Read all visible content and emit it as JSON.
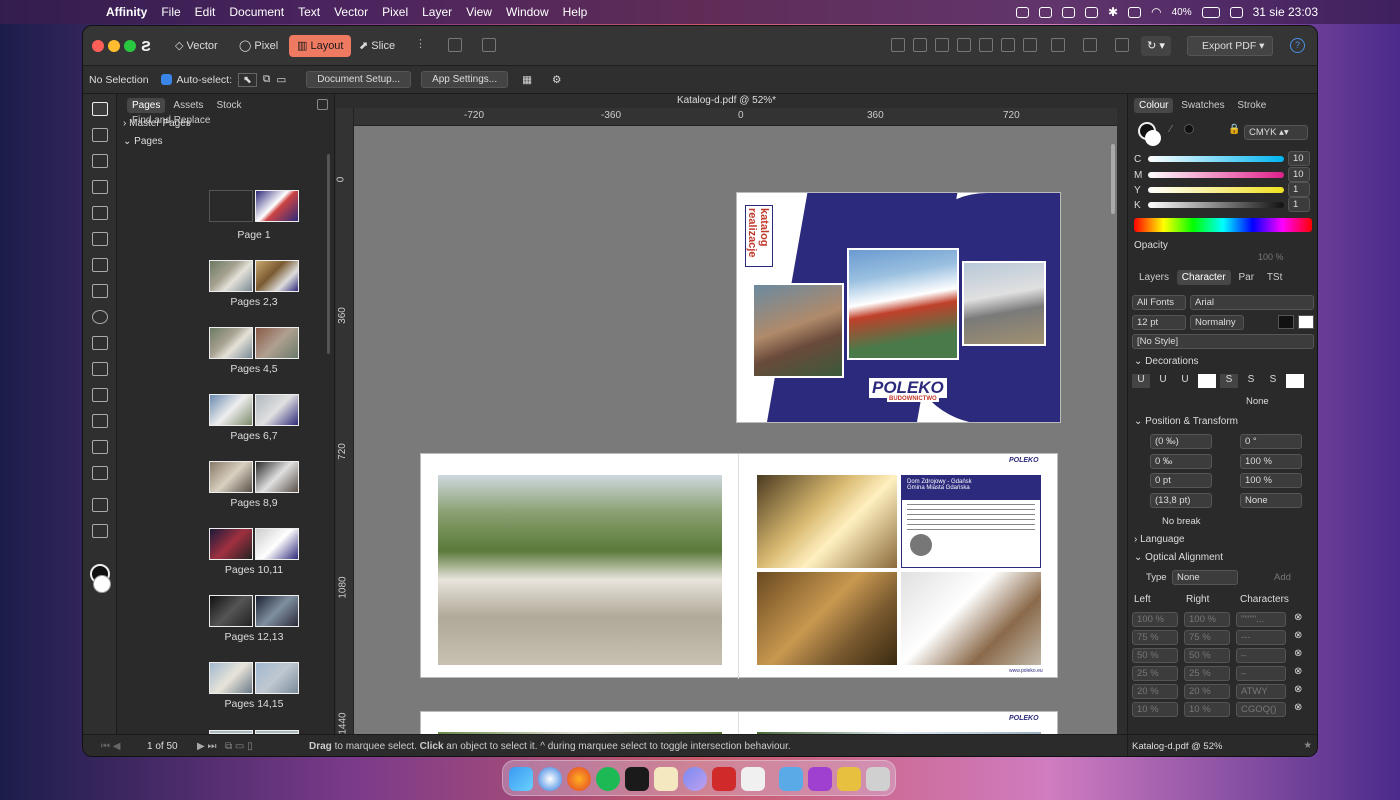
{
  "menubar": {
    "app": "Affinity",
    "items": [
      "File",
      "Edit",
      "Document",
      "Text",
      "Vector",
      "Pixel",
      "Layer",
      "View",
      "Window",
      "Help"
    ],
    "battery": "40%",
    "datetime": "31 sie  23:03"
  },
  "toolbar": {
    "personas": [
      "Vector",
      "Pixel",
      "Layout",
      "Slice"
    ],
    "active_persona": "Layout",
    "export": "Export PDF"
  },
  "context": {
    "selection": "No Selection",
    "autoselect": "Auto-select:",
    "doc_setup": "Document Setup...",
    "app_settings": "App Settings..."
  },
  "pages_panel": {
    "tabs": [
      "Pages",
      "Assets",
      "Stock",
      "Find and Replace"
    ],
    "master": "Master Pages",
    "pages_header": "Pages",
    "thumbs": [
      "Page 1",
      "Pages 2,3",
      "Pages 4,5",
      "Pages 6,7",
      "Pages 8,9",
      "Pages 10,11",
      "Pages 12,13",
      "Pages 14,15"
    ]
  },
  "document": {
    "title": "Katalog-d.pdf @ 52%*",
    "unit": "pt",
    "hticks": [
      "-720",
      "-360",
      "0",
      "360",
      "720"
    ],
    "vticks": [
      "0",
      "360",
      "720",
      "1080",
      "1440"
    ],
    "cover_title": "katalog realizacje",
    "brand": "POLEKO",
    "brand_sub": "BUDOWNICTWO",
    "page3_heading": "Dom Zdrojowy - Gdańsk",
    "page3_sub": "Gmina Miasta Gdańska",
    "web": "www.poleko.eu"
  },
  "right_panel": {
    "tabs1": [
      "Colour",
      "Swatches",
      "Stroke"
    ],
    "model": "CMYK",
    "channels": [
      {
        "k": "C",
        "v": "10"
      },
      {
        "k": "M",
        "v": "10"
      },
      {
        "k": "Y",
        "v": "1"
      },
      {
        "k": "K",
        "v": "1"
      }
    ],
    "opacity_label": "Opacity",
    "opacity": "100 %",
    "tabs2": [
      "Layers",
      "Character",
      "Par",
      "TSt"
    ],
    "font_family": "All Fonts",
    "font": "Arial",
    "size": "12 pt",
    "weight": "Normalny",
    "style": "[No Style]",
    "decorations": "Decorations",
    "none": "None",
    "pos_transform": "Position & Transform",
    "pt_fields": [
      "(0 ‰)",
      "0 °",
      "0 ‰",
      "100 %",
      "0 pt",
      "100 %",
      "(13,8 pt)",
      "None"
    ],
    "no_break": "No break",
    "language": "Language",
    "optical": "Optical Alignment",
    "type_label": "Type",
    "type_value": "None",
    "add": "Add",
    "cols": [
      "Left",
      "Right",
      "Characters"
    ],
    "rows": [
      [
        "100 %",
        "100 %",
        "\"\"\"\"'..."
      ],
      [
        "75 %",
        "75 %",
        "---"
      ],
      [
        "50 %",
        "50 %",
        "–"
      ],
      [
        "25 %",
        "25 %",
        "–"
      ],
      [
        "20 %",
        "20 %",
        "ATWY"
      ],
      [
        "10 %",
        "10 %",
        "CGOQ()"
      ]
    ]
  },
  "status": {
    "page": "1 of 50",
    "hint_bold1": "Drag",
    "hint1": " to marquee select. ",
    "hint_bold2": "Click",
    "hint2": " an object to select it. ^ during marquee select to toggle intersection behaviour.",
    "doc": "Katalog-d.pdf @ 52%"
  }
}
